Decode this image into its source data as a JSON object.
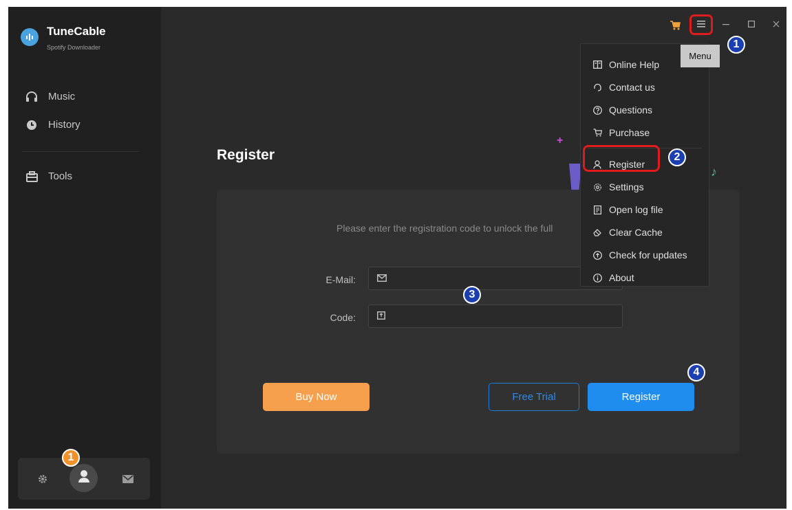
{
  "app": {
    "title": "TuneCable",
    "subtitle": "Spotify Downloader"
  },
  "sidebar": {
    "items": [
      {
        "label": "Music",
        "icon": "headphones-icon"
      },
      {
        "label": "History",
        "icon": "clock-icon"
      },
      {
        "label": "Tools",
        "icon": "toolbox-icon"
      }
    ]
  },
  "bottom_bar": {
    "icons": [
      "gear-icon",
      "user-icon",
      "mail-icon"
    ]
  },
  "titlebar": {
    "menu_tooltip": "Menu",
    "window_controls": [
      "minimize",
      "maximize",
      "close"
    ]
  },
  "menu": {
    "items": [
      {
        "label": "Online Help",
        "icon": "book-icon"
      },
      {
        "label": "Contact us",
        "icon": "headset-icon"
      },
      {
        "label": "Questions",
        "icon": "question-icon"
      },
      {
        "label": "Purchase",
        "icon": "cart-icon"
      },
      {
        "label": "Register",
        "icon": "user-icon"
      },
      {
        "label": "Settings",
        "icon": "gear-icon"
      },
      {
        "label": "Open log file",
        "icon": "file-icon"
      },
      {
        "label": "Clear Cache",
        "icon": "eraser-icon"
      },
      {
        "label": "Check for updates",
        "icon": "update-icon"
      },
      {
        "label": "About",
        "icon": "info-icon"
      }
    ]
  },
  "register": {
    "title": "Register",
    "instruction": "Please enter the registration code to unlock the full",
    "email_label": "E-Mail:",
    "email_value": "",
    "code_label": "Code:",
    "code_value": "",
    "buy_now": "Buy Now",
    "free_trial": "Free Trial",
    "register_button": "Register"
  },
  "annotations": {
    "badge_1": "1",
    "badge_2": "2",
    "badge_3": "3",
    "badge_4": "4",
    "badge_bottom": "1"
  },
  "colors": {
    "accent_blue": "#1f8df0",
    "accent_orange": "#f6a04d",
    "highlight_red": "#e01b1b"
  }
}
